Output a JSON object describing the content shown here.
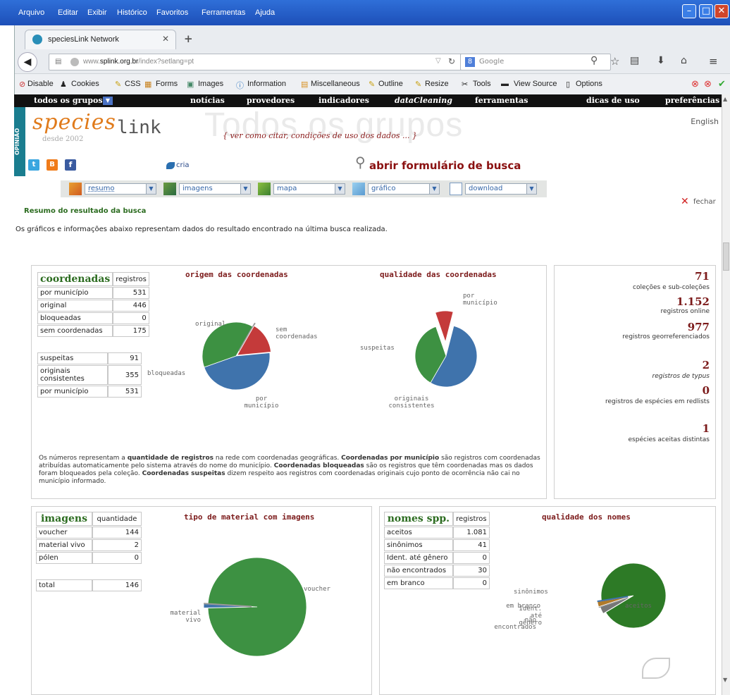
{
  "menubar": {
    "items": [
      "Arquivo",
      "Editar",
      "Exibir",
      "Histórico",
      "Favoritos",
      "Ferramentas",
      "Ajuda"
    ]
  },
  "browser": {
    "tab_title": "speciesLink Network",
    "url_prefix": "www.",
    "url_domain": "splink.org.br",
    "url_path": "/index?setlang=pt",
    "search_placeholder": "Google"
  },
  "devtoolbar": {
    "items": [
      "Disable",
      "Cookies",
      "CSS",
      "Forms",
      "Images",
      "Information",
      "Miscellaneous",
      "Outline",
      "Resize",
      "Tools",
      "View Source",
      "Options"
    ]
  },
  "sitenav": {
    "items": [
      "todos os grupos",
      "notícias",
      "provedores",
      "indicadores",
      "dataCleaning",
      "ferramentas",
      "dicas de uso",
      "preferências"
    ]
  },
  "header": {
    "logo_species": "species",
    "logo_link": "link",
    "since": "desde 2002",
    "watermark": "Todos os grupos",
    "cite": "{ ver como citar, condições de uso dos dados ... }",
    "lang": "English",
    "opiniao": "OPINIÃO",
    "cria": "cria",
    "search_link": "abrir formulário de busca"
  },
  "tabs": [
    "resumo",
    "imagens",
    "mapa",
    "gráfico",
    "download"
  ],
  "close_label": "fechar",
  "summary": {
    "title": "Resumo do resultado da busca",
    "intro": "Os gráficos e informações abaixo representam dados do resultado encontrado na última busca realizada."
  },
  "coords": {
    "title": "coordenadas",
    "col": "registros",
    "rows": [
      {
        "label": "por município",
        "value": "531"
      },
      {
        "label": "original",
        "value": "446"
      },
      {
        "label": "bloqueadas",
        "value": "0"
      },
      {
        "label": "sem coordenadas",
        "value": "175"
      }
    ],
    "rows2": [
      {
        "label": "suspeitas",
        "value": "91"
      },
      {
        "label": "originais consistentes",
        "value": "355"
      },
      {
        "label": "por município",
        "value": "531"
      }
    ],
    "chart1_title": "origem das coordenadas",
    "chart2_title": "qualidade das coordenadas",
    "note_parts": [
      "Os números representam a ",
      "quantidade de registros",
      " na rede com coordenadas geográficas. ",
      "Coordenadas por município",
      " são registros com coordenadas atribuídas automaticamente pelo sistema através do nome do município. ",
      "Coordenadas bloqueadas",
      " são os registros que têm coordenadas mas os dados foram bloqueados pela coleção. ",
      "Coordenadas suspeitas",
      " dizem respeito aos registros com coordenadas originais cujo ponto de ocorrência não cai no município informado."
    ]
  },
  "stats": [
    {
      "n": "71",
      "l": "coleções e sub-coleções"
    },
    {
      "n": "1.152",
      "l": "registros online"
    },
    {
      "n": "977",
      "l": "registros georreferenciados"
    },
    {
      "n": "2",
      "l": "registros de typus"
    },
    {
      "n": "0",
      "l": "registros de espécies em redlists"
    },
    {
      "n": "1",
      "l": "espécies aceitas distintas"
    }
  ],
  "images": {
    "title": "imagens",
    "col": "quantidade",
    "rows": [
      {
        "label": "voucher",
        "value": "144"
      },
      {
        "label": "material vivo",
        "value": "2"
      },
      {
        "label": "pólen",
        "value": "0"
      }
    ],
    "total_label": "total",
    "total_value": "146",
    "chart_title": "tipo de material com imagens"
  },
  "names": {
    "title": "nomes spp.",
    "col": "registros",
    "rows": [
      {
        "label": "aceitos",
        "value": "1.081"
      },
      {
        "label": "sinônimos",
        "value": "41"
      },
      {
        "label": "Ident. até gênero",
        "value": "0"
      },
      {
        "label": "não encontrados",
        "value": "30"
      },
      {
        "label": "em branco",
        "value": "0"
      }
    ],
    "chart_title": "qualidade dos nomes"
  },
  "chart_data": [
    {
      "type": "pie",
      "title": "origem das coordenadas",
      "categories": [
        "por município",
        "original",
        "bloqueadas",
        "sem coordenadas"
      ],
      "values": [
        531,
        446,
        0,
        175
      ],
      "colors": [
        "#3f73ac",
        "#3d9142",
        "#999999",
        "#c43a3a"
      ]
    },
    {
      "type": "pie",
      "title": "qualidade das coordenadas",
      "categories": [
        "por município",
        "originais consistentes",
        "suspeitas"
      ],
      "values": [
        531,
        355,
        91
      ],
      "colors": [
        "#3f73ac",
        "#3d9142",
        "#c43a3a"
      ]
    },
    {
      "type": "pie",
      "title": "tipo de material com imagens",
      "categories": [
        "voucher",
        "material vivo",
        "pólen"
      ],
      "values": [
        144,
        2,
        0
      ],
      "colors": [
        "#3d9142",
        "#3f73ac",
        "#999999"
      ]
    },
    {
      "type": "pie",
      "title": "qualidade dos nomes",
      "categories": [
        "aceitos",
        "sinônimos",
        "Ident. até gênero",
        "não encontrados",
        "em branco"
      ],
      "values": [
        1081,
        41,
        0,
        30,
        0
      ],
      "colors": [
        "#2d7a26",
        "#777777",
        "#999999",
        "#b07a2a",
        "#3f73ac"
      ]
    }
  ]
}
